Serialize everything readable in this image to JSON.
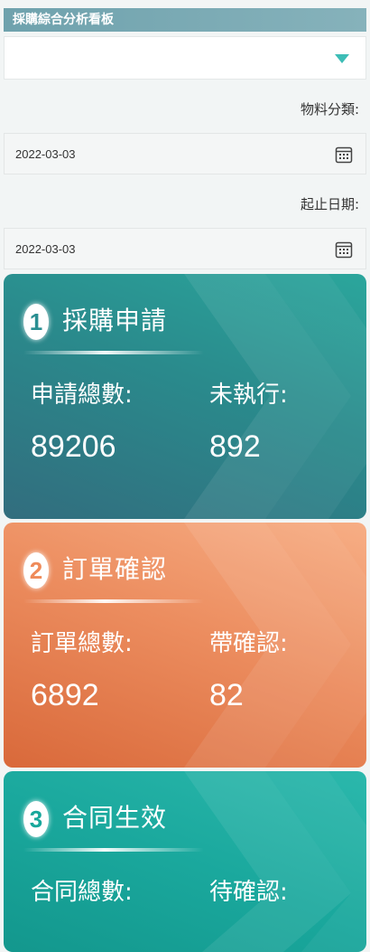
{
  "header": {
    "title": "採購綜合分析看板"
  },
  "filters": {
    "category_label": "物料分類:",
    "date_label": "起止日期:",
    "date_start": "2022-03-03",
    "date_end": "2022-03-03"
  },
  "cards": [
    {
      "num": "1",
      "title": "採購申請",
      "label1": "申請總數:",
      "value1": "89206",
      "label2": "未執行:",
      "value2": "892"
    },
    {
      "num": "2",
      "title": "訂單確認",
      "label1": "訂單總數:",
      "value1": "6892",
      "label2": "帶確認:",
      "value2": "82"
    },
    {
      "num": "3",
      "title": "合同生效",
      "label1": "合同總數:",
      "label2": "待確認:"
    }
  ],
  "icons": {
    "dropdown": "triangle-down-icon",
    "calendar": "calendar-icon"
  },
  "colors": {
    "header": "#78a8b2",
    "card1": "#2a8a8c",
    "card2": "#ec8d5f",
    "card3": "#1aa89d",
    "accent": "#3dbdb6"
  }
}
